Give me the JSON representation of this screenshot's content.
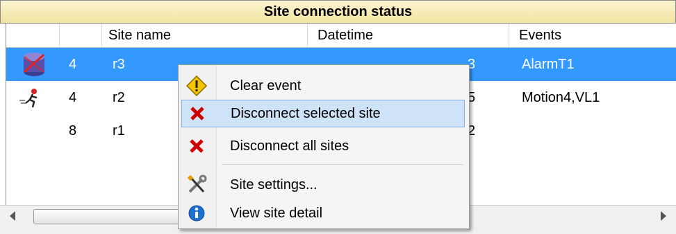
{
  "panel": {
    "title": "Site connection status"
  },
  "columns": {
    "site_name": "Site name",
    "datetime": "Datetime",
    "events": "Events"
  },
  "rows": [
    {
      "icon": "database-icon",
      "count": "4",
      "site": "r3",
      "datetime_tail": "3",
      "events": "AlarmT1",
      "selected": true
    },
    {
      "icon": "running-man-icon",
      "count": "4",
      "site": "r2",
      "datetime_tail": "5",
      "events": "Motion4,VL1",
      "selected": false
    },
    {
      "icon": "",
      "count": "8",
      "site": "r1",
      "datetime_tail": "2",
      "events": "",
      "selected": false
    }
  ],
  "context_menu": {
    "items": [
      {
        "label": "Clear event",
        "icon": "warning-icon"
      },
      {
        "label": "Disconnect selected site",
        "icon": "red-x-icon",
        "highlighted": true
      },
      {
        "label": "Disconnect all sites",
        "icon": "red-x-icon"
      },
      {
        "label": "Site settings...",
        "icon": "tools-icon"
      },
      {
        "label": "View site detail",
        "icon": "info-icon"
      }
    ]
  },
  "colors": {
    "selection": "#3399ff",
    "menu_highlight": "#cfe3f8",
    "title_bg": "#f1e3a0"
  }
}
